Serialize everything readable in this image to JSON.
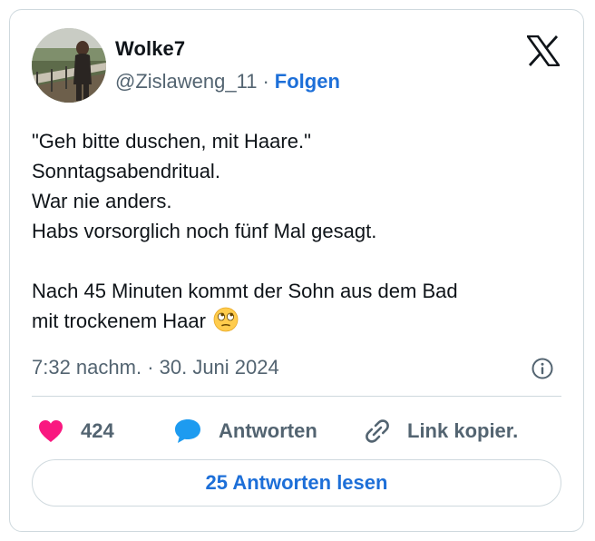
{
  "author": {
    "display_name": "Wolke7",
    "handle": "@Zislaweng_11",
    "separator": "·",
    "follow_label": "Folgen"
  },
  "tweet": {
    "lines": [
      "\"Geh bitte duschen, mit Haare.\"",
      "Sonntagsabendritual.",
      "War nie anders.",
      "Habs vorsorglich noch fünf Mal gesagt.",
      "",
      "Nach 45 Minuten kommt der Sohn aus dem Bad",
      "mit trockenem Haar"
    ],
    "emoji": "face-with-rolling-eyes",
    "timestamp": "7:32 nachm. · 30. Juni 2024"
  },
  "actions": {
    "like_count": "424",
    "reply_label": "Antworten",
    "copy_link_label": "Link kopier.",
    "read_replies_label": "25 Antworten lesen"
  },
  "icons": {
    "logo": "x-logo-icon",
    "info": "info-icon",
    "like": "heart-icon",
    "reply": "speech-bubble-icon",
    "link": "link-icon"
  },
  "colors": {
    "accent": "#1d6fd8",
    "heart": "#f91880",
    "reply_bubble": "#1d9bf0",
    "muted_text": "#536471",
    "border": "#cfd9de"
  }
}
